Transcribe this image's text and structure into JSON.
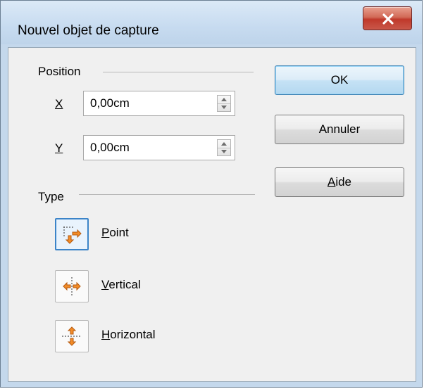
{
  "window": {
    "title": "Nouvel objet de capture",
    "close_label": "X"
  },
  "position": {
    "heading": "Position",
    "x": {
      "label": "X",
      "value": "0,00cm"
    },
    "y": {
      "label": "Y",
      "value": "0,00cm"
    }
  },
  "type": {
    "heading": "Type",
    "options": [
      {
        "label": "Point",
        "icon": "point-snap-icon",
        "selected": true
      },
      {
        "label": "Vertical",
        "icon": "vertical-snap-icon",
        "selected": false
      },
      {
        "label": "Horizontal",
        "icon": "horizontal-snap-icon",
        "selected": false
      }
    ]
  },
  "buttons": {
    "ok": "OK",
    "cancel": "Annuler",
    "help": "Aide"
  },
  "colors": {
    "accent": "#3c84c8",
    "close": "#c0392b",
    "frame": "#c4d8ec"
  }
}
